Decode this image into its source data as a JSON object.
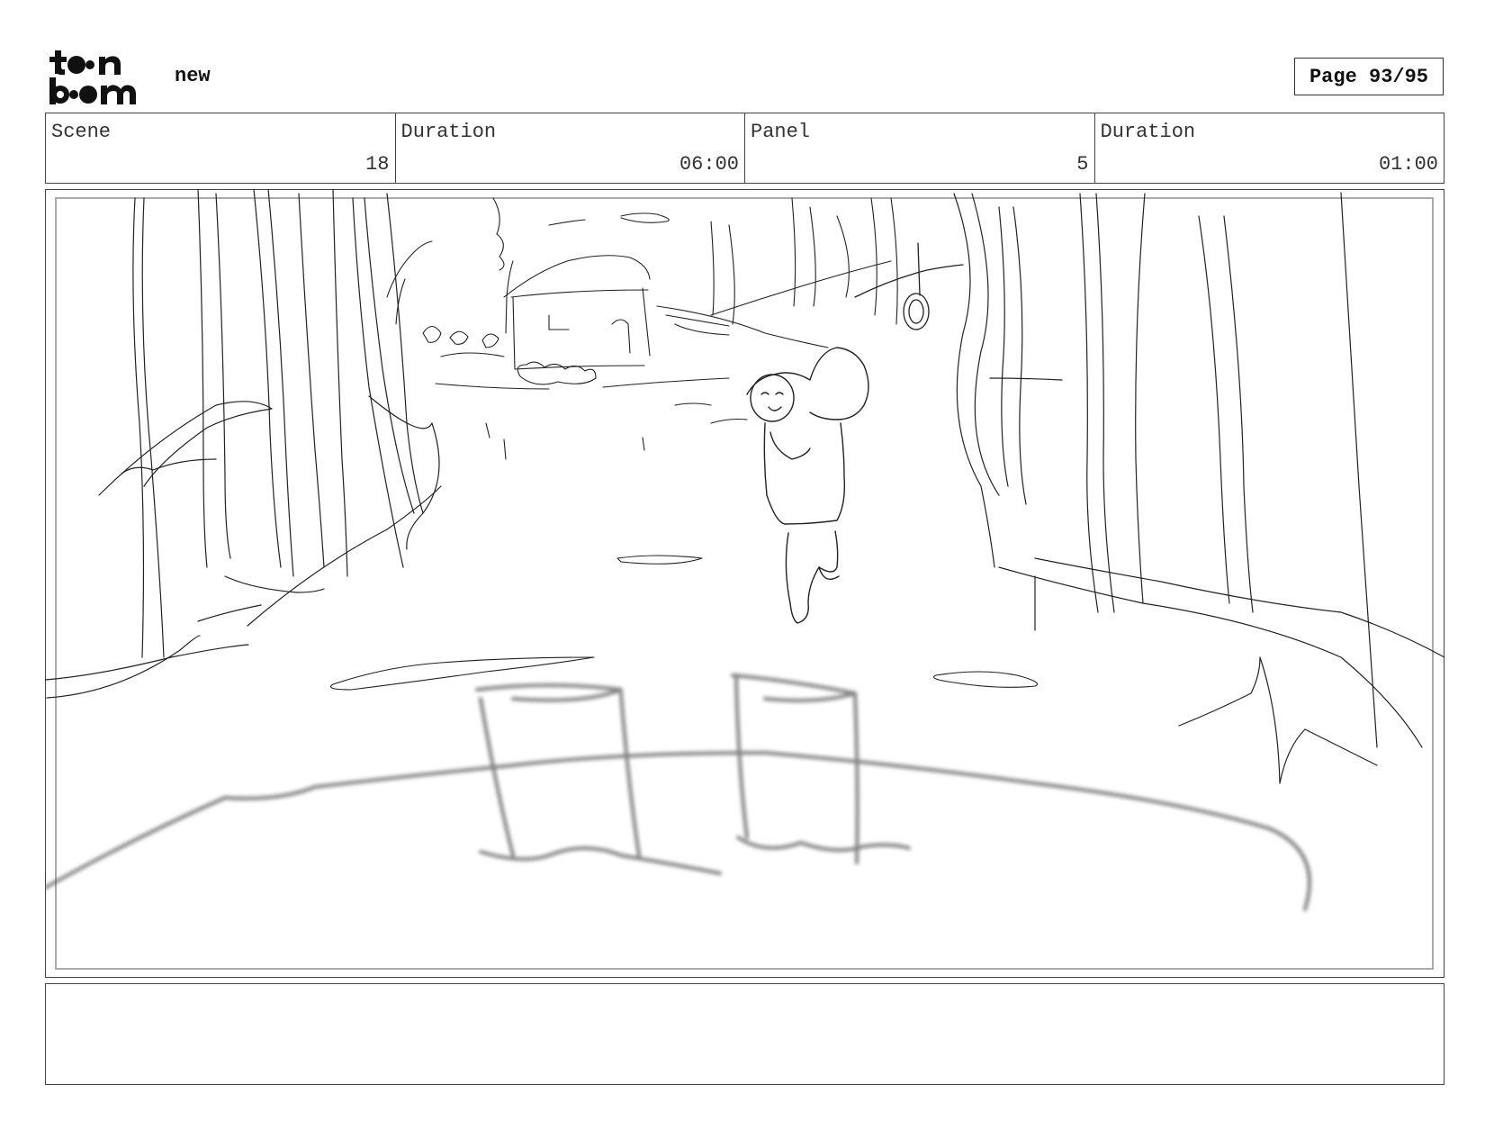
{
  "header": {
    "logo_text": "toon boom",
    "project_name": "new",
    "page_label": "Page 93/95"
  },
  "info": [
    {
      "label": "Scene",
      "value": "18"
    },
    {
      "label": "Duration",
      "value": "06:00"
    },
    {
      "label": "Panel",
      "value": "5"
    },
    {
      "label": "Duration",
      "value": "01:00"
    }
  ],
  "panel": {
    "description": "Rough pencil storyboard sketch of a forest path with a smiling character walking toward the camera, a small house and bushes in the background, a tire swing hanging from a tree, and blurred foreground posts."
  },
  "notes": {
    "text": ""
  }
}
